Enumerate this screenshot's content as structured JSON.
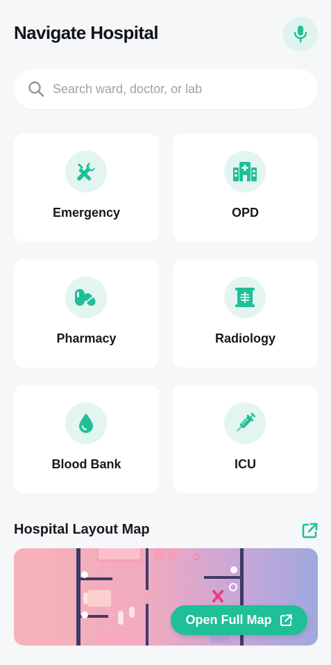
{
  "header": {
    "title": "Navigate Hospital",
    "mic_icon": "microphone-icon"
  },
  "search": {
    "placeholder": "Search ward, doctor, or lab",
    "value": "",
    "icon": "search-icon"
  },
  "departments": [
    {
      "label": "Emergency",
      "icon": "tools-icon"
    },
    {
      "label": "OPD",
      "icon": "hospital-building-icon"
    },
    {
      "label": "Pharmacy",
      "icon": "pills-icon"
    },
    {
      "label": "Radiology",
      "icon": "x-ray-icon"
    },
    {
      "label": "Blood Bank",
      "icon": "blood-drop-icon"
    },
    {
      "label": "ICU",
      "icon": "syringe-icon"
    }
  ],
  "map_section": {
    "title": "Hospital Layout Map",
    "open_button_label": "Open Full Map",
    "external_icon": "external-link-icon"
  },
  "colors": {
    "accent": "#1fbf98",
    "icon_bg": "#e3f5f0",
    "background": "#f5f7f9",
    "card": "#ffffff"
  }
}
